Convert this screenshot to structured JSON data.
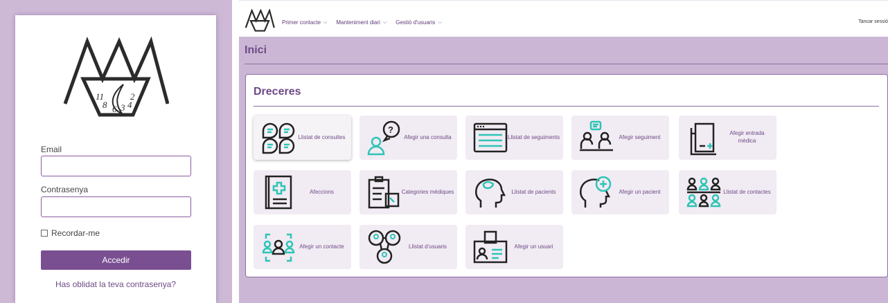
{
  "login": {
    "logo_digits": [
      "11",
      "2",
      "8",
      "6",
      "3",
      "4"
    ],
    "email_label": "Email",
    "email_value": "",
    "password_label": "Contrasenya",
    "password_value": "",
    "remember_label": "Recordar-me",
    "remember_checked": false,
    "submit_label": "Accedir",
    "forgot_label": "Has oblidat la teva contrasenya?"
  },
  "app": {
    "nav": [
      {
        "label": "Primer contacte",
        "icon": "chevron-down-icon"
      },
      {
        "label": "Manteniment diari",
        "icon": "chevron-down-icon"
      },
      {
        "label": "Gestió d'usuaris",
        "icon": "chevron-down-icon"
      }
    ],
    "logout_label": "Tancar sessió",
    "page_title": "Inici",
    "panel_title": "Dreceres",
    "tiles": [
      {
        "label": "Llistat de consultes",
        "icon": "chat-bubbles-icon",
        "active": true
      },
      {
        "label": "Afegir una consulta",
        "icon": "ask-question-icon",
        "active": false
      },
      {
        "label": "Llistat de seguiments",
        "icon": "browser-list-icon",
        "active": false
      },
      {
        "label": "Afegir seguiment",
        "icon": "consultation-icon",
        "active": false
      },
      {
        "label": "Afegir entrada mèdica",
        "icon": "medical-folder-icon",
        "active": false
      },
      {
        "label": "Afeccions",
        "icon": "medical-book-icon",
        "active": false
      },
      {
        "label": "Categories mèdiques",
        "icon": "clipboard-boxes-icon",
        "active": false
      },
      {
        "label": "Llistat de pacients",
        "icon": "head-puzzle-icon",
        "active": false
      },
      {
        "label": "Afegir un pacient",
        "icon": "head-plus-icon",
        "active": false
      },
      {
        "label": "Llistat de contactes",
        "icon": "people-grid-icon",
        "active": false
      },
      {
        "label": "Afegir un contacte",
        "icon": "people-focus-icon",
        "active": false
      },
      {
        "label": "Llistat d'usuaris",
        "icon": "user-network-icon",
        "active": false
      },
      {
        "label": "Afegir un usuari",
        "icon": "id-badge-icon",
        "active": false
      }
    ],
    "colors": {
      "primary": "#7a4f92",
      "accent_teal": "#2ec4b6",
      "background": "#cbb7d5"
    }
  }
}
